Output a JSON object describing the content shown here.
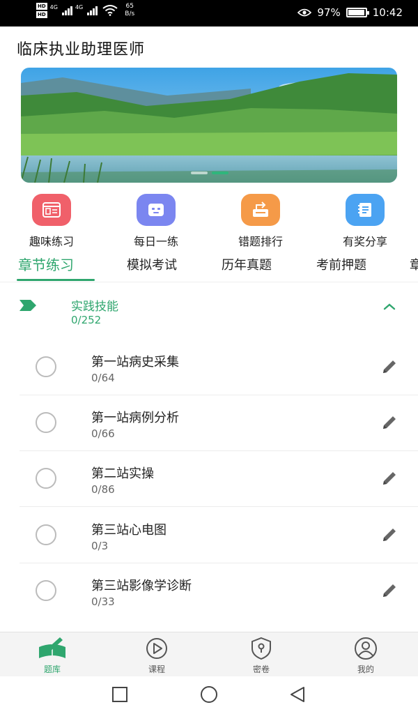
{
  "status_bar": {
    "hd1": "HD",
    "hd2": "HD",
    "net1": "4G",
    "net2": "4G",
    "speed_value": "65",
    "speed_unit": "B/s",
    "battery": "97%",
    "battery_level": 0.97,
    "time": "10:42"
  },
  "app": {
    "title": "临床执业助理医师"
  },
  "banner": {
    "slide_count": 2,
    "active_slide": 2
  },
  "quick_actions": [
    {
      "label": "趣味练习",
      "icon": "exam-paper-icon",
      "color": "#f0606a"
    },
    {
      "label": "每日一练",
      "icon": "robot-face-icon",
      "color": "#7b86f0"
    },
    {
      "label": "错题排行",
      "icon": "wrong-rank-icon",
      "color": "#f59a48"
    },
    {
      "label": "有奖分享",
      "icon": "share-book-icon",
      "color": "#4ba3f2"
    }
  ],
  "tabs": [
    {
      "label": "章节练习",
      "active": true
    },
    {
      "label": "模拟考试",
      "active": false
    },
    {
      "label": "历年真题",
      "active": false
    },
    {
      "label": "考前押题",
      "active": false
    },
    {
      "label": "章",
      "active": false
    }
  ],
  "chapter": {
    "title": "实践技能",
    "progress": "0/252",
    "expanded": true
  },
  "sections": [
    {
      "name": "第一站病史采集",
      "progress": "0/64"
    },
    {
      "name": "第一站病例分析",
      "progress": "0/66"
    },
    {
      "name": "第二站实操",
      "progress": "0/86"
    },
    {
      "name": "第三站心电图",
      "progress": "0/3"
    },
    {
      "name": "第三站影像学诊断",
      "progress": "0/33"
    }
  ],
  "bottom_nav": [
    {
      "label": "题库",
      "icon": "question-bank-icon",
      "active": true
    },
    {
      "label": "课程",
      "icon": "play-circle-icon",
      "active": false
    },
    {
      "label": "密卷",
      "icon": "shield-lock-icon",
      "active": false
    },
    {
      "label": "我的",
      "icon": "user-icon",
      "active": false
    }
  ],
  "colors": {
    "accent": "#2fa66e",
    "text": "#222222",
    "muted": "#666666"
  }
}
